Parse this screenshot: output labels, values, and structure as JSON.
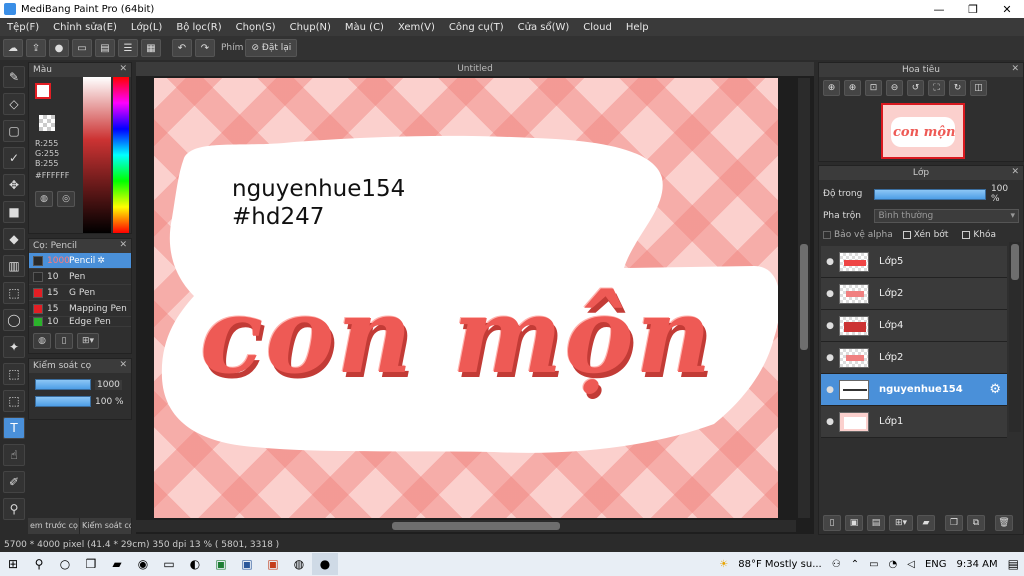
{
  "app": {
    "title": "MediBang Paint Pro (64bit)"
  },
  "window_controls": {
    "minimize": "—",
    "maximize": "❐",
    "close": "✕"
  },
  "menu": [
    "Tệp(F)",
    "Chỉnh sửa(E)",
    "Lớp(L)",
    "Bộ lọc(R)",
    "Chọn(S)",
    "Chụp(N)",
    "Màu (C)",
    "Xem(V)",
    "Công cụ(T)",
    "Cửa sổ(W)",
    "Cloud",
    "Help"
  ],
  "toolbar": {
    "shortcut_label": "Phím",
    "clear_label": "Đặt lại"
  },
  "color_panel": {
    "title": "Màu",
    "rgb_r": "R:255",
    "rgb_g": "G:255",
    "rgb_b": "B:255",
    "hex": "#FFFFFF"
  },
  "brush_panel": {
    "title": "Cọ: Pencil",
    "items": [
      {
        "size": "1000",
        "name": "Pencil",
        "color": "#2a2a2a"
      },
      {
        "size": "10",
        "name": "Pen",
        "color": "#2a2a2a"
      },
      {
        "size": "15",
        "name": "G Pen",
        "color": "#e31e24"
      },
      {
        "size": "15",
        "name": "Mapping Pen",
        "color": "#e31e24"
      },
      {
        "size": "10",
        "name": "Edge Pen",
        "color": "#2bb32b"
      }
    ]
  },
  "brush_control": {
    "title": "Kiểm soát cọ",
    "size": "1000",
    "opacity": "100 %"
  },
  "bottom_tabs": [
    "em trước cọ",
    "Kiểm soát cọ"
  ],
  "document": {
    "title": "Untitled"
  },
  "canvas": {
    "line1": "nguyenhue154",
    "line2": "#hd247",
    "lettering": "con mộn"
  },
  "navigator": {
    "title": "Hoa tiêu",
    "thumb_text": "con mộn"
  },
  "layers": {
    "title": "Lớp",
    "opacity_label": "Độ trong",
    "opacity_value": "100 %",
    "opacity": 1.0,
    "blend_label": "Pha trộn",
    "blend_value": "Bình thường",
    "protect_alpha": "Bảo vệ alpha",
    "clipping": "Xén bớt",
    "lock": "Khóa",
    "items": [
      {
        "name": "Lớp5"
      },
      {
        "name": "Lớp2"
      },
      {
        "name": "Lớp4"
      },
      {
        "name": "Lớp2"
      },
      {
        "name": "nguyenhue154"
      },
      {
        "name": "Lớp1"
      }
    ]
  },
  "status": {
    "text": "5700 * 4000 pixel   (41.4 * 29cm)   350 dpi   13 %   ( 5801, 3318 )"
  },
  "taskbar": {
    "weather": "88°F  Mostly su...",
    "lang": "ENG",
    "time": "9:34 AM"
  },
  "colors": {
    "accent": "#4a90d9",
    "brand_red": "#e31e24",
    "canvas_pink": "#fbd0cd"
  }
}
